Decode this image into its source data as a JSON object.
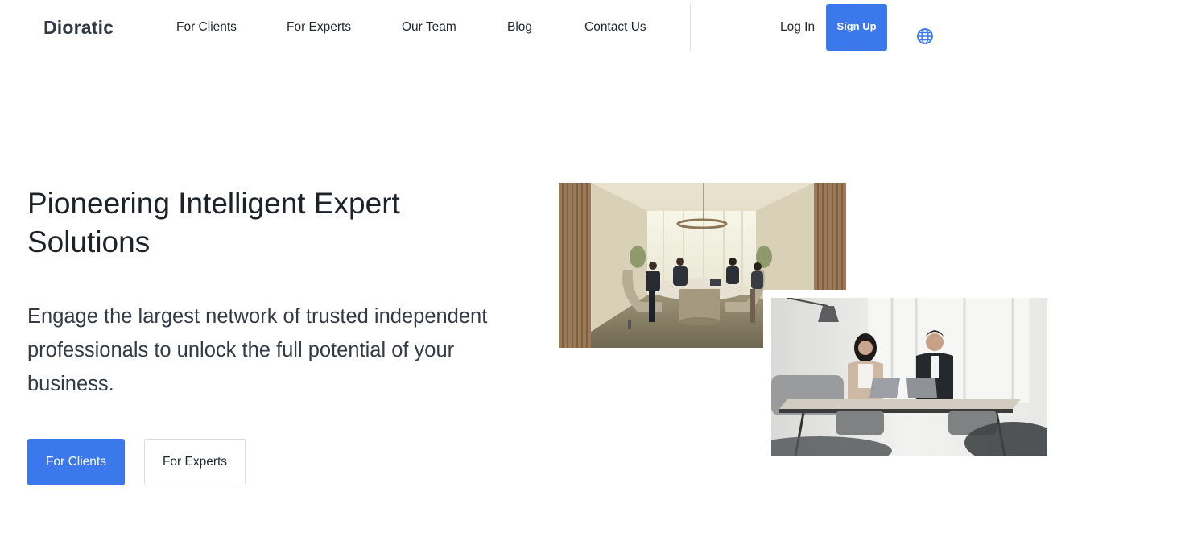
{
  "header": {
    "logo": "Dioratic",
    "nav": [
      "For Clients",
      "For Experts",
      "Our Team",
      "Blog",
      "Contact Us"
    ],
    "login": "Log In",
    "signup": "Sign Up",
    "language_icon": "globe-icon"
  },
  "hero": {
    "title": "Pioneering Intelligent Expert Solutions",
    "subtitle": "Engage the largest network of trusted independent professionals to unlock the full potential of your business.",
    "primary_button": "For Clients",
    "secondary_button": "For Experts"
  },
  "colors": {
    "accent": "#3b78ec",
    "text": "#1d2128"
  }
}
